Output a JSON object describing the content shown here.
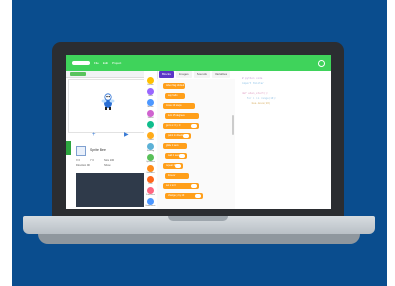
{
  "app": {
    "menu": [
      "File",
      "Edit",
      "Project"
    ]
  },
  "editor": {
    "tabs": [
      "Blocks",
      "Images",
      "Sounds",
      "Variables"
    ],
    "active_tab": "Blocks"
  },
  "sprite": {
    "name": "Sprite Bee",
    "props": [
      "X 0",
      "Y 0",
      "Size 100",
      "Direction 90",
      "Show"
    ]
  },
  "categories": [
    {
      "label": "Events",
      "color": "#ffbf00"
    },
    {
      "label": "Looks",
      "color": "#9966ff"
    },
    {
      "label": "Motion",
      "color": "#4c97ff"
    },
    {
      "label": "Sound",
      "color": "#cf63cf"
    },
    {
      "label": "Pen",
      "color": "#0fbd8c"
    },
    {
      "label": "Control",
      "color": "#ffab19"
    },
    {
      "label": "Sensing",
      "color": "#5cb1d6"
    },
    {
      "label": "Operators",
      "color": "#59c059"
    },
    {
      "label": "Variables",
      "color": "#ff8c1a"
    },
    {
      "label": "Lists",
      "color": "#ff661a"
    },
    {
      "label": "Functions",
      "color": "#ff6680"
    },
    {
      "label": "Extensions",
      "color": "#4c97ff"
    }
  ],
  "blocks": [
    {
      "label": "when flag clicked"
    },
    {
      "label": "say hello"
    },
    {
      "label": "move 10 steps"
    },
    {
      "label": "turn 15 degrees"
    },
    {
      "label": "go to x: 0 y: 0"
    },
    {
      "label": "point in direction 90"
    },
    {
      "label": "glide 1 secs"
    },
    {
      "label": "wait 1 seconds"
    },
    {
      "label": "repeat 10"
    },
    {
      "label": "forever"
    },
    {
      "label": "set x to 0"
    },
    {
      "label": "change y by 10"
    }
  ],
  "code": {
    "lines": [
      "# python code",
      "import tkinter",
      "",
      "def when_start():",
      "    for i in range(10):",
      "        bee.move(10)"
    ]
  },
  "colors": {
    "topbar": "#3fd35b",
    "accent_purple": "#5b36c7",
    "block_orange": "#ff9f1a",
    "background_blue": "#0a4d8e"
  }
}
